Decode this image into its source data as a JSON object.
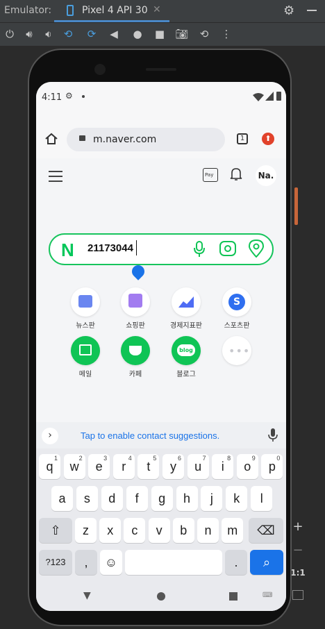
{
  "emulator": {
    "label": "Emulator:",
    "tab_title": "Pixel 4 API 30",
    "tab_close": "✕",
    "settings_icon": "gear-icon",
    "zoom_reset": "1:1",
    "zoom_in": "+",
    "zoom_out": "−"
  },
  "status_bar": {
    "time": "4:11"
  },
  "browser": {
    "url": "m.naver.com",
    "tab_count": "1"
  },
  "naver": {
    "logo": "N",
    "profile": "Na.",
    "pay_badge": "Pay",
    "search_query": "21173044",
    "shortcuts": [
      {
        "label": "뉴스판",
        "icon": "news-icon",
        "color": "#6a86f0"
      },
      {
        "label": "쇼핑판",
        "icon": "shopping-bag-icon",
        "color": "#a27cf0"
      },
      {
        "label": "경제지표판",
        "icon": "chart-trend-icon",
        "color": "#4e6cf4"
      },
      {
        "label": "스포츠판",
        "icon": "sports-icon",
        "color": "#2f6ff0"
      },
      {
        "label": "메일",
        "icon": "mail-icon",
        "color": "#0fc455"
      },
      {
        "label": "카페",
        "icon": "cafe-icon",
        "color": "#0fc455"
      },
      {
        "label": "블로그",
        "icon": "blog-icon",
        "color": "#0fc455"
      },
      {
        "label": "",
        "icon": "more-icon",
        "color": "#dadbe0"
      }
    ],
    "blog_badge": "blog"
  },
  "keyboard": {
    "suggestion": "Tap to enable contact suggestions.",
    "row1": [
      "q",
      "w",
      "e",
      "r",
      "t",
      "y",
      "u",
      "i",
      "o",
      "p"
    ],
    "row1_nums": [
      "1",
      "2",
      "3",
      "4",
      "5",
      "6",
      "7",
      "8",
      "9",
      "0"
    ],
    "row2": [
      "a",
      "s",
      "d",
      "f",
      "g",
      "h",
      "j",
      "k",
      "l"
    ],
    "row3": [
      "z",
      "x",
      "c",
      "v",
      "b",
      "n",
      "m"
    ],
    "symbols": "?123",
    "comma": ",",
    "period": "."
  }
}
